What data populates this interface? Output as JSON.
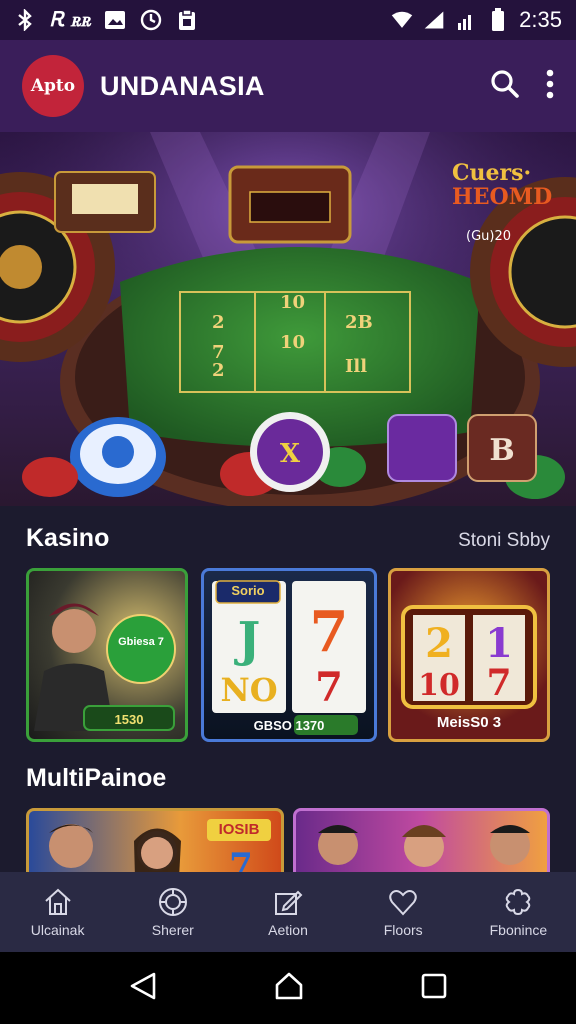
{
  "status_bar": {
    "carrier_text": "Ꭱ ꭱꭱ",
    "time": "2:35"
  },
  "app_bar": {
    "logo_text": "Apto",
    "title": "UNDANASIA"
  },
  "hero": {
    "banner_title_line1": "Cuers·",
    "banner_title_line2": "HEOMD",
    "banner_sub": "(Gu)20"
  },
  "section_kasino": {
    "title": "Kasino",
    "link": "Stoni Sbby",
    "tiles": [
      {
        "label": "1530",
        "badge": "Gbiesa 7"
      },
      {
        "label": "GBSO  1370",
        "reel_top": "Sorio"
      },
      {
        "label": "MeisS0 3"
      }
    ]
  },
  "section_multi": {
    "title": "MultiPainoe",
    "tiles": [
      {
        "badge": "IOSIB"
      },
      {
        "badge": ""
      }
    ]
  },
  "bottom_nav": {
    "items": [
      {
        "label": "Ulcainak",
        "icon": "home-icon"
      },
      {
        "label": "Sherer",
        "icon": "casino-chip-icon"
      },
      {
        "label": "Aetion",
        "icon": "edit-icon"
      },
      {
        "label": "Floors",
        "icon": "heart-icon"
      },
      {
        "label": "Fbonince",
        "icon": "gear-flower-icon"
      }
    ]
  },
  "colors": {
    "app_bar": "#3a1e5a",
    "status_bar": "#24123c",
    "page_bg": "#1c1b2e",
    "bottom_nav": "#2a2a44",
    "logo": "#c2243a"
  }
}
